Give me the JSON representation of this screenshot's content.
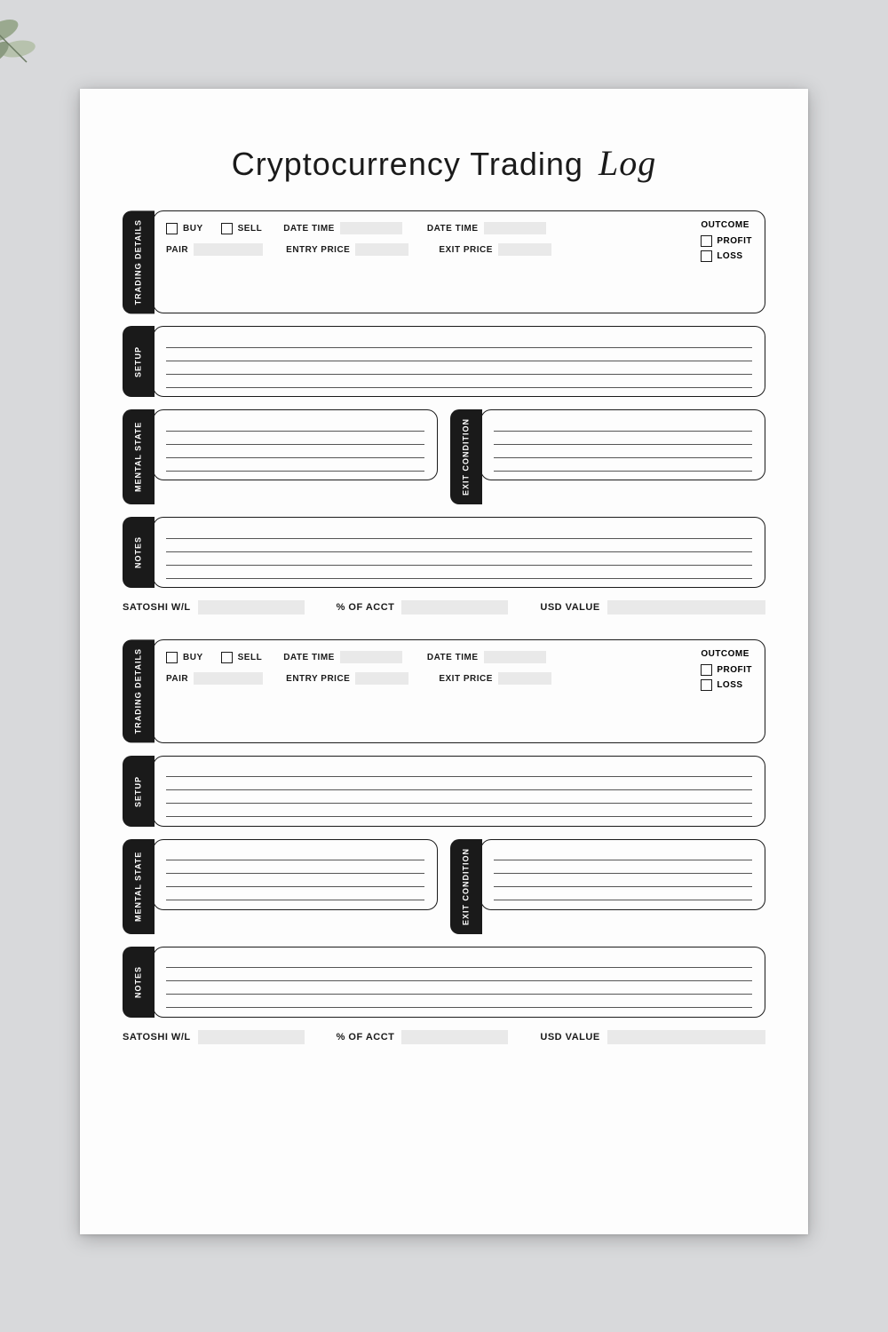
{
  "title_main": "Cryptocurrency Trading",
  "title_script": "Log",
  "labels": {
    "trading_details": "TRADING DETAILS",
    "setup": "SETUP",
    "mental_state": "MENTAL STATE",
    "exit_condition": "EXIT CONDITION",
    "notes": "NOTES",
    "buy": "BUY",
    "sell": "SELL",
    "date_time": "DATE TIME",
    "pair": "PAIR",
    "entry_price": "ENTRY PRICE",
    "exit_price": "EXIT PRICE",
    "outcome": "OUTCOME",
    "profit": "PROFIT",
    "loss": "LOSS",
    "satoshi": "SATOSHI W/L",
    "pct_acct": "% OF ACCT",
    "usd_value": "USD VALUE"
  }
}
